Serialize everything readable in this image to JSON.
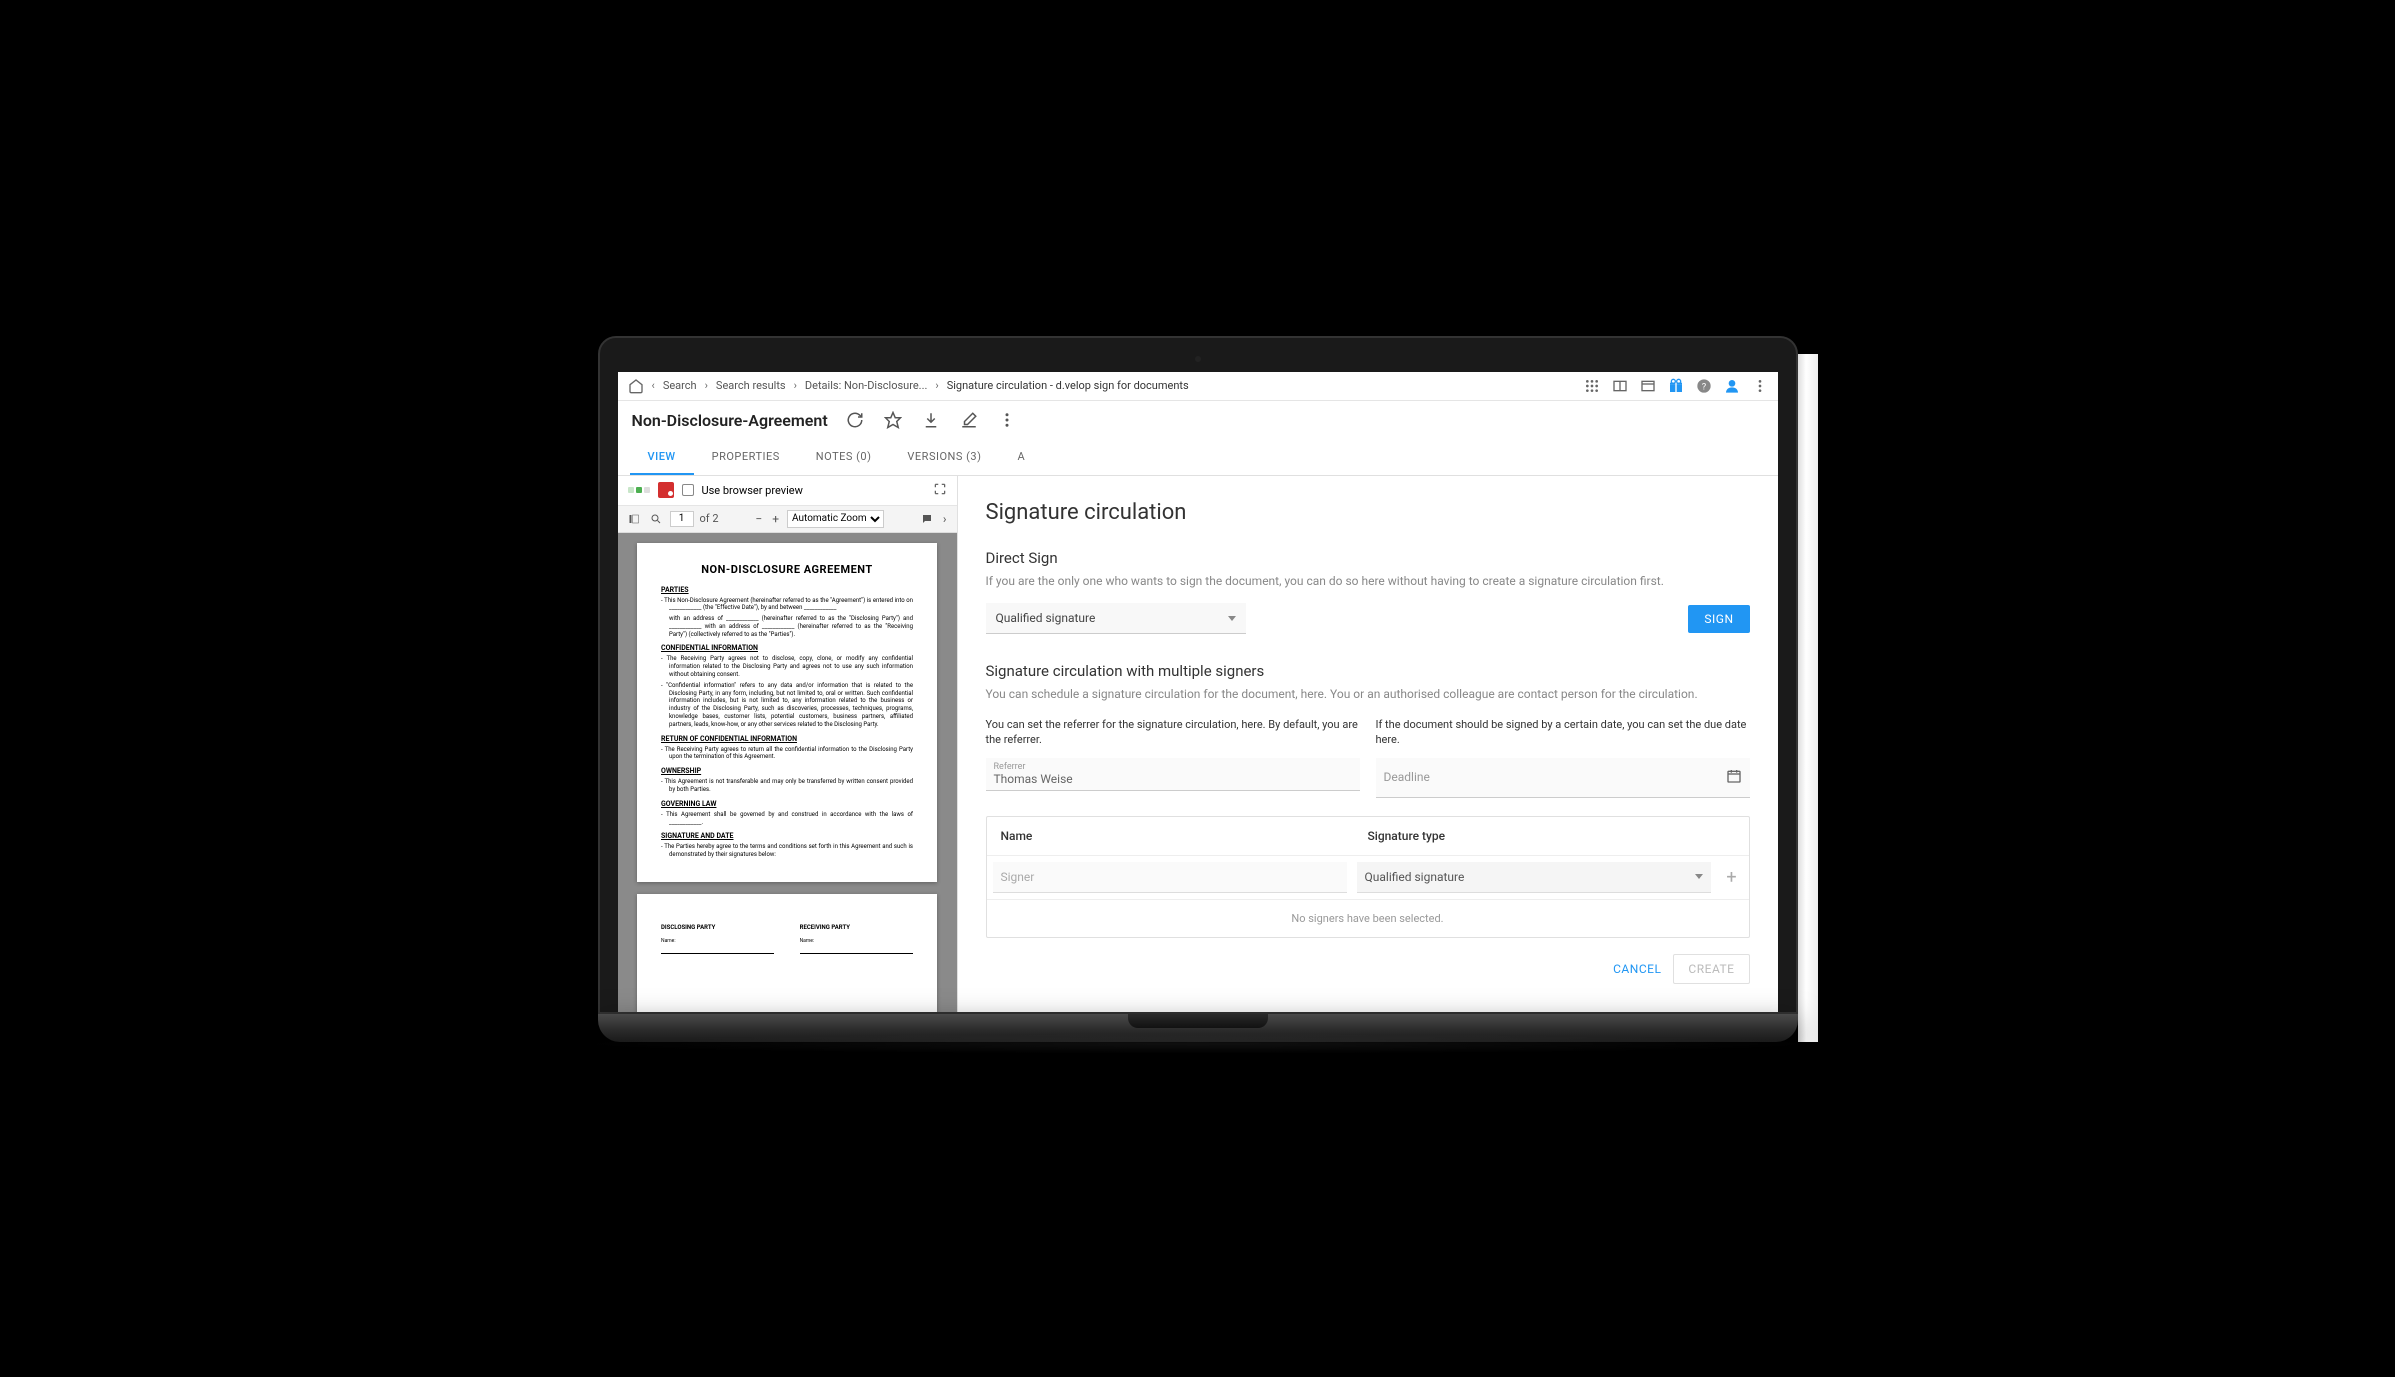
{
  "breadcrumbs": {
    "items": [
      "Search",
      "Search results",
      "Details: Non-Disclosure...",
      "Signature circulation - d.velop sign for documents"
    ]
  },
  "document": {
    "title": "Non-Disclosure-Agreement",
    "tabs": {
      "view": "VIEW",
      "properties": "PROPERTIES",
      "notes": "NOTES (0)",
      "versions": "VERSIONS (3)",
      "trail": "A"
    },
    "preview_checkbox_label": "Use browser preview",
    "pdf": {
      "page_current": "1",
      "page_sep": "of 2",
      "zoom_mode": "Automatic Zoom"
    },
    "content": {
      "heading": "NON-DISCLOSURE AGREEMENT",
      "parties_h": "PARTIES",
      "parties_1": "This Non-Disclosure Agreement (hereinafter referred to as the \"Agreement\") is entered into on ____________ (the \"Effective Date\"), by and between ____________",
      "parties_2": "with an address of ____________ (hereinafter referred to as the \"Disclosing Party\") and ____________ with an address of ____________ (hereinafter referred to as the \"Receiving Party\") (collectively referred to as the \"Parties\").",
      "conf_h": "CONFIDENTIAL INFORMATION",
      "conf_1": "The Receiving Party agrees not to disclose, copy, clone, or modify any confidential information related to the Disclosing Party and agrees not to use any such information without obtaining consent.",
      "conf_2": "\"Confidential information\" refers to any data and/or information that is related to the Disclosing Party, in any form, including, but not limited to, oral or written. Such confidential information includes, but is not limited to, any information related to the business or industry of the Disclosing Party, such as discoveries, processes, techniques, programs, knowledge bases, customer lists, potential customers, business partners, affiliated partners, leads, know-how, or any other services related to the Disclosing Party.",
      "return_h": "RETURN OF CONFIDENTIAL INFORMATION",
      "return_1": "The Receiving Party agrees to return all the confidential information to the Disclosing Party upon the termination of this Agreement.",
      "own_h": "OWNERSHIP",
      "own_1": "This Agreement is not transferable and may only be transferred by written consent provided by both Parties.",
      "gov_h": "GOVERNING LAW",
      "gov_1": "This Agreement shall be governed by and construed in accordance with the laws of ____________.",
      "sig_h": "SIGNATURE AND DATE",
      "sig_1": "The Parties hereby agree to the terms and conditions set forth in this Agreement and such is demonstrated by their signatures below:",
      "disclosing": "DISCLOSING PARTY",
      "receiving": "RECEIVING PARTY",
      "name_lbl": "Name:"
    }
  },
  "signature": {
    "title": "Signature circulation",
    "direct_h": "Direct Sign",
    "direct_desc": "If you are the only one who wants to sign the document, you can do so here without having to create a signature circulation first.",
    "signature_type": "Qualified signature",
    "sign_btn": "SIGN",
    "multi_h": "Signature circulation with multiple signers",
    "multi_desc": "You can schedule a signature circulation for the document, here. You or an authorised colleague are contact person for the circulation.",
    "referrer_help": "You can set the referrer for the signature circulation, here. By default, you are the referrer.",
    "deadline_help": "If the document should be signed by a certain date, you can set the due date here.",
    "referrer_label": "Referrer",
    "referrer_value": "Thomas Weise",
    "deadline_placeholder": "Deadline",
    "table": {
      "col_name": "Name",
      "col_type": "Signature type",
      "signer_placeholder": "Signer",
      "type_value": "Qualified signature",
      "empty": "No signers have been selected."
    },
    "cancel": "CANCEL",
    "create": "CREATE"
  }
}
